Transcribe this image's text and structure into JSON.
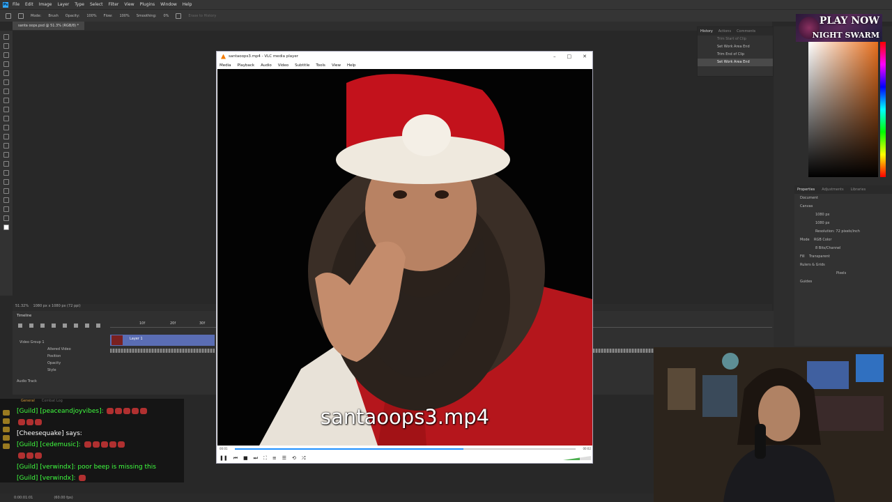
{
  "photoshop": {
    "menus": [
      "File",
      "Edit",
      "Image",
      "Layer",
      "Type",
      "Select",
      "Filter",
      "View",
      "Plugins",
      "Window",
      "Help"
    ],
    "options": {
      "mode_label": "Mode:",
      "mode_value": "Brush",
      "opacity_label": "Opacity:",
      "opacity_value": "100%",
      "flow_label": "Flow:",
      "flow_value": "100%",
      "smoothing_label": "Smoothing:",
      "smoothing_value": "0%",
      "erase_label": "Erase to History"
    },
    "doc_tab": "santa oops.psd @ 51.3% (RGB/8) *",
    "status": {
      "zoom": "51.32%",
      "dims": "1080 px x 1080 px (72 ppi)"
    },
    "timeline": {
      "title": "Timeline",
      "group": "Video Group 1",
      "layer": "Layer 1",
      "props": [
        "Altered Video",
        "Position",
        "Opacity",
        "Style"
      ],
      "audio": "Audio Track",
      "ruler": [
        "10f",
        "20f",
        "30f"
      ]
    },
    "history": {
      "tabs": [
        "History",
        "Actions",
        "Comments"
      ],
      "rows": [
        "Trim Start of Clip",
        "Set Work Area End",
        "Trim End of Clip",
        "Set Work Area End"
      ]
    },
    "properties": {
      "tabs": [
        "Properties",
        "Adjustments",
        "Libraries"
      ],
      "doc": "Document",
      "canvas": "Canvas",
      "w": "1080 px",
      "h": "1080 px",
      "resolution": "Resolution: 72 pixels/inch",
      "mode_label": "Mode",
      "mode": "RGB Color",
      "depth": "8 Bits/Channel",
      "fill_label": "Fill",
      "fill": "Transparent",
      "rulers": "Rulers & Grids",
      "units": "Pixels",
      "guides": "Guides"
    },
    "bottom": {
      "time": "0:00:01:01",
      "fps": "(60.00 fps)"
    }
  },
  "promo": {
    "line1": "PLAY NOW",
    "line2": "NIGHT SWARM"
  },
  "vlc": {
    "title": "santaoops3.mp4 - VLC media player",
    "menu": [
      "Media",
      "Playback",
      "Audio",
      "Video",
      "Subtitle",
      "Tools",
      "View",
      "Help"
    ],
    "subtitle": "santaoops3.mp4",
    "elapsed": "00:01",
    "total": "00:02",
    "progress": 0.67,
    "volume": 0.6
  },
  "chat": {
    "tabs": [
      "General",
      "Combat Log"
    ],
    "lines": [
      {
        "text": "[Guild] [peaceandjoyvibes]: "
      },
      {
        "text": ""
      },
      {
        "text": "[Cheesequake] says: "
      },
      {
        "text": "[Guild] [cedemusic]: "
      },
      {
        "text": ""
      },
      {
        "text": "[Guild] [verwindx]: poor beep is missing this"
      },
      {
        "text": "[Guild] [verwindx]: "
      }
    ]
  },
  "colors": {
    "accent": "#31a8ff",
    "vlc_seek": "#1e90ff",
    "santa_red": "#c0181e",
    "chat_guild": "#40ff40"
  }
}
